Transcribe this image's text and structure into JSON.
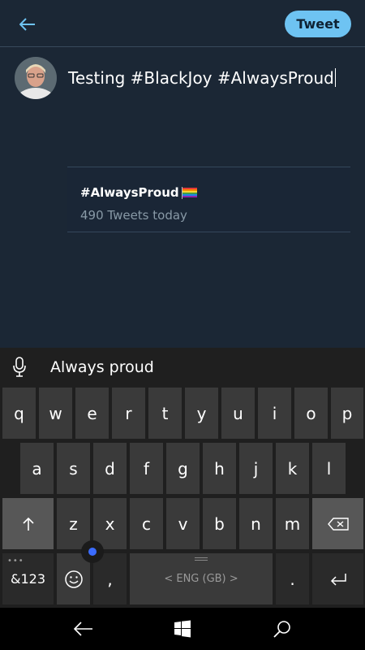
{
  "header": {
    "back_icon": "arrow-left-icon",
    "tweet_label": "Tweet",
    "accent": "#6ec3f2"
  },
  "compose": {
    "text": "Testing #BlackJoy #AlwaysProud"
  },
  "suggestion": {
    "hashtag": "#AlwaysProud",
    "emoji": "rainbow-flag",
    "count_text": "490 Tweets today"
  },
  "keyboard": {
    "prediction": "Always proud",
    "row1": [
      "q",
      "w",
      "e",
      "r",
      "t",
      "y",
      "u",
      "i",
      "o",
      "p"
    ],
    "row2": [
      "a",
      "s",
      "d",
      "f",
      "g",
      "h",
      "j",
      "k",
      "l"
    ],
    "row3": [
      "z",
      "x",
      "c",
      "v",
      "b",
      "n",
      "m"
    ],
    "numbers_label": "&123",
    "comma": ",",
    "space_label": "< ENG (GB) >",
    "period": ".",
    "shift_icon": "shift-arrow-icon",
    "backspace_icon": "backspace-icon",
    "enter_icon": "enter-icon",
    "emoji_icon": "smiley-icon",
    "mic_icon": "microphone-icon"
  },
  "navbar": {
    "back_icon": "nav-back-icon",
    "home_icon": "windows-logo-icon",
    "search_icon": "search-icon"
  }
}
